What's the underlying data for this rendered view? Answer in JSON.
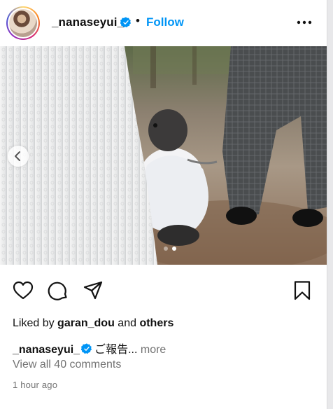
{
  "post": {
    "username": "_nanaseyui_",
    "separator": "•",
    "follow_label": "Follow",
    "more_options_icon": "more-horizontal-icon",
    "verified_icon": "verified-badge-icon",
    "carousel": {
      "current": 2,
      "total": 2
    },
    "likes": {
      "prefix": "Liked by",
      "user": "garan_dou",
      "middle": "and",
      "others": "others"
    },
    "caption": {
      "user": "_nanaseyui_",
      "text": "ご報告...",
      "more": "more"
    },
    "comments_label": "View all 40 comments",
    "timestamp": "1 hour ago",
    "actions": [
      "heart-icon",
      "comment-icon",
      "share-icon",
      "bookmark-icon"
    ]
  },
  "colors": {
    "accent": "#0095f6",
    "secondary_text": "#737373",
    "verified": "#0095f6"
  }
}
